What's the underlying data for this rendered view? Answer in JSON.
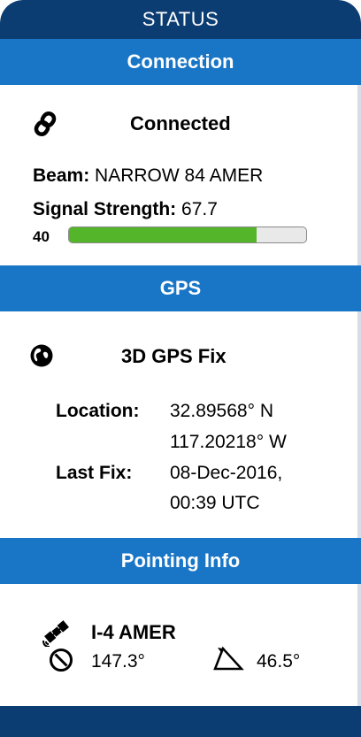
{
  "header": {
    "title": "STATUS"
  },
  "connection": {
    "section_title": "Connection",
    "icon": "link-icon",
    "status": "Connected",
    "beam_label": "Beam:",
    "beam_value": "NARROW 84 AMER",
    "signal_label": "Signal Strength:",
    "signal_value": "67.7",
    "signal_min_label": "40",
    "signal_fraction": 0.79,
    "signal_bar_color": "#54b52a"
  },
  "gps": {
    "section_title": "GPS",
    "icon": "globe-icon",
    "fix_status": "3D GPS Fix",
    "location_label": "Location:",
    "latitude": "32.89568° N",
    "longitude": "117.20218° W",
    "last_fix_label": "Last Fix:",
    "last_fix_date": "08-Dec-2016,",
    "last_fix_time": "00:39 UTC"
  },
  "pointing": {
    "section_title": "Pointing Info",
    "satellite_icon": "satellite-icon",
    "satellite_name": "I-4 AMER",
    "azimuth_icon": "compass-icon",
    "azimuth": "147.3°",
    "elevation_icon": "elevation-angle-icon",
    "elevation": "46.5°"
  },
  "colors": {
    "header_dark": "#0c3d72",
    "section_blue": "#1976c6",
    "signal_green": "#54b52a"
  }
}
